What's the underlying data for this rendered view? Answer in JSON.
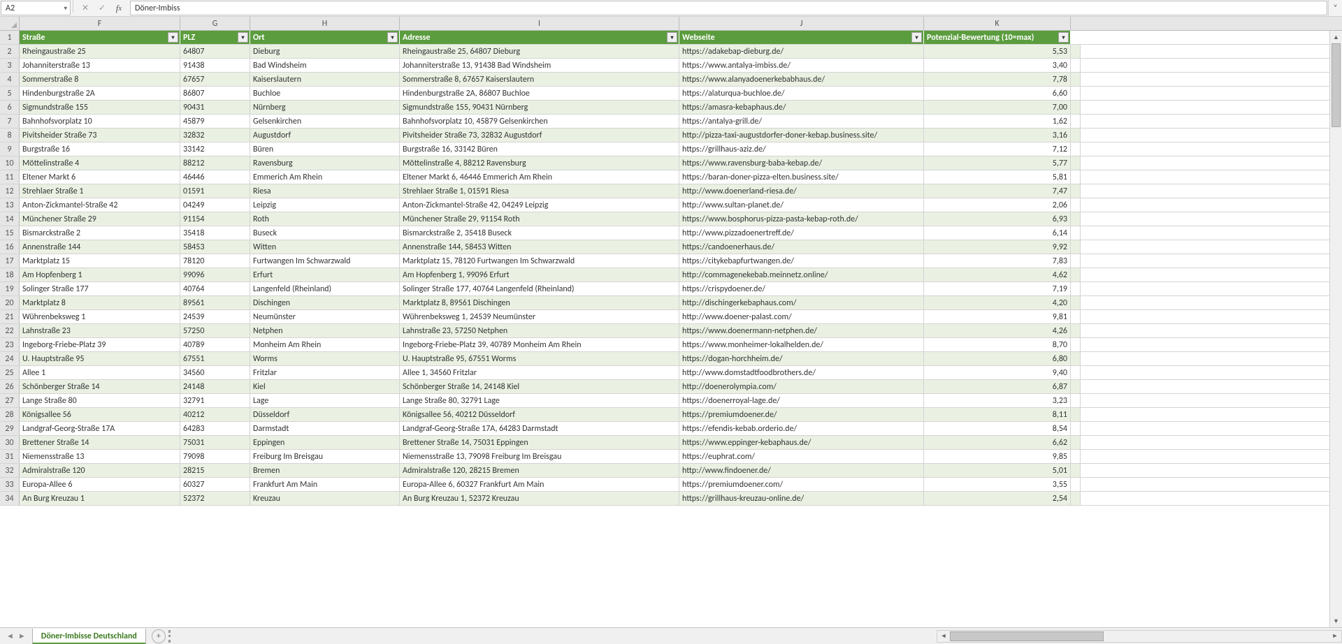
{
  "formula_bar": {
    "name_box": "A2",
    "formula_value": "Döner-Imbiss"
  },
  "columns": [
    {
      "letter": "F",
      "header": "Straße",
      "cls": "c-F",
      "align": "left",
      "key": "strasse"
    },
    {
      "letter": "G",
      "header": "PLZ",
      "cls": "c-G",
      "align": "left",
      "key": "plz"
    },
    {
      "letter": "H",
      "header": "Ort",
      "cls": "c-H",
      "align": "left",
      "key": "ort"
    },
    {
      "letter": "I",
      "header": "Adresse",
      "cls": "c-I",
      "align": "left",
      "key": "adresse"
    },
    {
      "letter": "J",
      "header": "Webseite",
      "cls": "c-J",
      "align": "left",
      "key": "webseite"
    },
    {
      "letter": "K",
      "header": "Potenzial-Bewertung (10=max)",
      "cls": "c-K",
      "align": "right",
      "key": "potenzial"
    }
  ],
  "rows": [
    {
      "n": 2,
      "strasse": "Rheingaustraße 25",
      "plz": "64807",
      "ort": "Dieburg",
      "adresse": "Rheingaustraße 25, 64807 Dieburg",
      "webseite": "https://adakebap-dieburg.de/",
      "potenzial": "5,53"
    },
    {
      "n": 3,
      "strasse": "Johanniterstraße 13",
      "plz": "91438",
      "ort": "Bad Windsheim",
      "adresse": "Johanniterstraße 13, 91438 Bad Windsheim",
      "webseite": "https://www.antalya-imbiss.de/",
      "potenzial": "3,40"
    },
    {
      "n": 4,
      "strasse": "Sommerstraße 8",
      "plz": "67657",
      "ort": "Kaiserslautern",
      "adresse": "Sommerstraße 8, 67657 Kaiserslautern",
      "webseite": "https://www.alanyadoenerkebabhaus.de/",
      "potenzial": "7,78"
    },
    {
      "n": 5,
      "strasse": "Hindenburgstraße 2A",
      "plz": "86807",
      "ort": "Buchloe",
      "adresse": "Hindenburgstraße 2A, 86807 Buchloe",
      "webseite": "https://alaturqua-buchloe.de/",
      "potenzial": "6,60"
    },
    {
      "n": 6,
      "strasse": "Sigmundstraße 155",
      "plz": "90431",
      "ort": "Nürnberg",
      "adresse": "Sigmundstraße 155, 90431 Nürnberg",
      "webseite": "https://amasra-kebaphaus.de/",
      "potenzial": "7,00"
    },
    {
      "n": 7,
      "strasse": "Bahnhofsvorplatz 10",
      "plz": "45879",
      "ort": "Gelsenkirchen",
      "adresse": "Bahnhofsvorplatz 10, 45879 Gelsenkirchen",
      "webseite": "https://antalya-grill.de/",
      "potenzial": "1,62"
    },
    {
      "n": 8,
      "strasse": "Pivitsheider Straße 73",
      "plz": "32832",
      "ort": "Augustdorf",
      "adresse": "Pivitsheider Straße 73, 32832 Augustdorf",
      "webseite": "http://pizza-taxi-augustdorfer-doner-kebap.business.site/",
      "potenzial": "3,16"
    },
    {
      "n": 9,
      "strasse": "Burgstraße 16",
      "plz": "33142",
      "ort": "Büren",
      "adresse": "Burgstraße 16, 33142 Büren",
      "webseite": "https://grillhaus-aziz.de/",
      "potenzial": "7,12"
    },
    {
      "n": 10,
      "strasse": "Möttelinstraße 4",
      "plz": "88212",
      "ort": "Ravensburg",
      "adresse": "Möttelinstraße 4, 88212 Ravensburg",
      "webseite": "https://www.ravensburg-baba-kebap.de/",
      "potenzial": "5,77"
    },
    {
      "n": 11,
      "strasse": "Eltener Markt 6",
      "plz": "46446",
      "ort": "Emmerich Am Rhein",
      "adresse": "Eltener Markt 6, 46446 Emmerich Am Rhein",
      "webseite": "https://baran-doner-pizza-elten.business.site/",
      "potenzial": "5,81"
    },
    {
      "n": 12,
      "strasse": "Strehlaer Straße 1",
      "plz": "01591",
      "ort": "Riesa",
      "adresse": "Strehlaer Straße 1, 01591 Riesa",
      "webseite": "http://www.doenerland-riesa.de/",
      "potenzial": "7,47"
    },
    {
      "n": 13,
      "strasse": "Anton-Zickmantel-Straße 42",
      "plz": "04249",
      "ort": "Leipzig",
      "adresse": "Anton-Zickmantel-Straße 42, 04249 Leipzig",
      "webseite": "http://www.sultan-planet.de/",
      "potenzial": "2,06"
    },
    {
      "n": 14,
      "strasse": "Münchener Straße 29",
      "plz": "91154",
      "ort": "Roth",
      "adresse": "Münchener Straße 29, 91154 Roth",
      "webseite": "https://www.bosphorus-pizza-pasta-kebap-roth.de/",
      "potenzial": "6,93"
    },
    {
      "n": 15,
      "strasse": "Bismarckstraße 2",
      "plz": "35418",
      "ort": "Buseck",
      "adresse": "Bismarckstraße 2, 35418 Buseck",
      "webseite": "http://www.pizzadoenertreff.de/",
      "potenzial": "6,14"
    },
    {
      "n": 16,
      "strasse": "Annenstraße 144",
      "plz": "58453",
      "ort": "Witten",
      "adresse": "Annenstraße 144, 58453 Witten",
      "webseite": "https://candoenerhaus.de/",
      "potenzial": "9,92"
    },
    {
      "n": 17,
      "strasse": "Marktplatz 15",
      "plz": "78120",
      "ort": "Furtwangen Im Schwarzwald",
      "adresse": "Marktplatz 15, 78120 Furtwangen Im Schwarzwald",
      "webseite": "https://citykebapfurtwangen.de/",
      "potenzial": "7,83"
    },
    {
      "n": 18,
      "strasse": "Am Hopfenberg 1",
      "plz": "99096",
      "ort": "Erfurt",
      "adresse": "Am Hopfenberg 1, 99096 Erfurt",
      "webseite": "http://commagenekebab.meinnetz.online/",
      "potenzial": "4,62"
    },
    {
      "n": 19,
      "strasse": "Solinger Straße 177",
      "plz": "40764",
      "ort": "Langenfeld (Rheinland)",
      "adresse": "Solinger Straße 177, 40764 Langenfeld (Rheinland)",
      "webseite": "https://crispydoener.de/",
      "potenzial": "7,19"
    },
    {
      "n": 20,
      "strasse": "Marktplatz 8",
      "plz": "89561",
      "ort": "Dischingen",
      "adresse": "Marktplatz 8, 89561 Dischingen",
      "webseite": "http://dischingerkebaphaus.com/",
      "potenzial": "4,20"
    },
    {
      "n": 21,
      "strasse": "Wührenbeksweg 1",
      "plz": "24539",
      "ort": "Neumünster",
      "adresse": "Wührenbeksweg 1, 24539 Neumünster",
      "webseite": "http://www.doener-palast.com/",
      "potenzial": "9,81"
    },
    {
      "n": 22,
      "strasse": "Lahnstraße 23",
      "plz": "57250",
      "ort": "Netphen",
      "adresse": "Lahnstraße 23, 57250 Netphen",
      "webseite": "https://www.doenermann-netphen.de/",
      "potenzial": "4,26"
    },
    {
      "n": 23,
      "strasse": "Ingeborg-Friebe-Platz 39",
      "plz": "40789",
      "ort": "Monheim Am Rhein",
      "adresse": "Ingeborg-Friebe-Platz 39, 40789 Monheim Am Rhein",
      "webseite": "https://www.monheimer-lokalhelden.de/",
      "potenzial": "8,70"
    },
    {
      "n": 24,
      "strasse": "U. Hauptstraße 95",
      "plz": "67551",
      "ort": "Worms",
      "adresse": "U. Hauptstraße 95, 67551 Worms",
      "webseite": "https://dogan-horchheim.de/",
      "potenzial": "6,80"
    },
    {
      "n": 25,
      "strasse": "Allee 1",
      "plz": "34560",
      "ort": "Fritzlar",
      "adresse": "Allee 1, 34560 Fritzlar",
      "webseite": "http://www.domstadtfoodbrothers.de/",
      "potenzial": "9,40"
    },
    {
      "n": 26,
      "strasse": "Schönberger Straße 14",
      "plz": "24148",
      "ort": "Kiel",
      "adresse": "Schönberger Straße 14, 24148 Kiel",
      "webseite": "http://doenerolympia.com/",
      "potenzial": "6,87"
    },
    {
      "n": 27,
      "strasse": "Lange Straße 80",
      "plz": "32791",
      "ort": "Lage",
      "adresse": "Lange Straße 80, 32791 Lage",
      "webseite": "https://doenerroyal-lage.de/",
      "potenzial": "3,23"
    },
    {
      "n": 28,
      "strasse": "Königsallee 56",
      "plz": "40212",
      "ort": "Düsseldorf",
      "adresse": "Königsallee 56, 40212 Düsseldorf",
      "webseite": "https://premiumdoener.de/",
      "potenzial": "8,11"
    },
    {
      "n": 29,
      "strasse": "Landgraf-Georg-Straße 17A",
      "plz": "64283",
      "ort": "Darmstadt",
      "adresse": "Landgraf-Georg-Straße 17A, 64283 Darmstadt",
      "webseite": "https://efendis-kebab.orderio.de/",
      "potenzial": "8,54"
    },
    {
      "n": 30,
      "strasse": "Brettener Straße 14",
      "plz": "75031",
      "ort": "Eppingen",
      "adresse": "Brettener Straße 14, 75031 Eppingen",
      "webseite": "https://www.eppinger-kebaphaus.de/",
      "potenzial": "6,62"
    },
    {
      "n": 31,
      "strasse": "Niemensstraße 13",
      "plz": "79098",
      "ort": "Freiburg Im Breisgau",
      "adresse": "Niemensstraße 13, 79098 Freiburg Im Breisgau",
      "webseite": "https://euphrat.com/",
      "potenzial": "9,85"
    },
    {
      "n": 32,
      "strasse": "Admiralstraße 120",
      "plz": "28215",
      "ort": "Bremen",
      "adresse": "Admiralstraße 120, 28215 Bremen",
      "webseite": "http://www.findoener.de/",
      "potenzial": "5,01"
    },
    {
      "n": 33,
      "strasse": "Europa-Allee 6",
      "plz": "60327",
      "ort": "Frankfurt Am Main",
      "adresse": "Europa-Allee 6, 60327 Frankfurt Am Main",
      "webseite": "https://premiumdoener.com/",
      "potenzial": "3,55"
    },
    {
      "n": 34,
      "strasse": "An Burg Kreuzau 1",
      "plz": "52372",
      "ort": "Kreuzau",
      "adresse": "An Burg Kreuzau 1, 52372 Kreuzau",
      "webseite": "https://grillhaus-kreuzau-online.de/",
      "potenzial": "2,54"
    }
  ],
  "sheet_tab": "Döner-Imbisse Deutschland",
  "icons": {
    "dropdown": "▾",
    "cancel": "✕",
    "accept": "✓",
    "expand": "˅",
    "nav_first": "◄",
    "nav_last": "►",
    "plus": "+",
    "up": "▲",
    "down": "▼",
    "left": "◄",
    "right": "►"
  }
}
